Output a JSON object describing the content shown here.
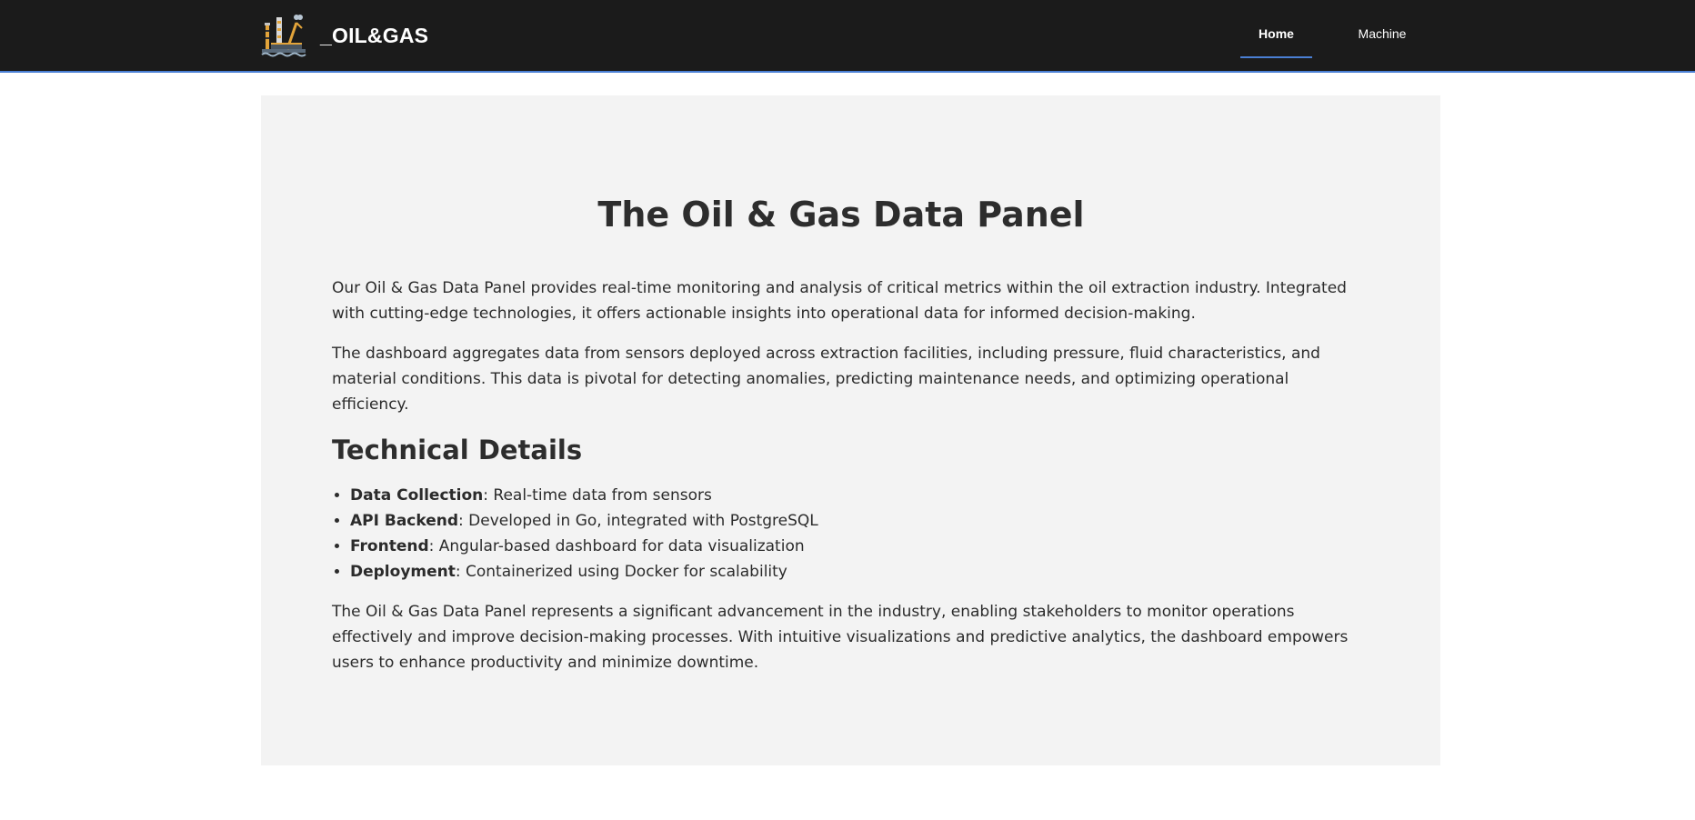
{
  "header": {
    "brand_name": "_OIL&GAS",
    "logo_icon": "oil-refinery-icon",
    "nav": [
      {
        "label": "Home",
        "active": true
      },
      {
        "label": "Machine",
        "active": false
      }
    ],
    "accent_color": "#4a7fd4",
    "background_color": "#1b1b1b"
  },
  "main": {
    "title": "The Oil & Gas Data Panel",
    "intro_paragraphs": [
      "Our Oil & Gas Data Panel provides real-time monitoring and analysis of critical metrics within the oil extraction industry. Integrated with cutting-edge technologies, it offers actionable insights into operational data for informed decision-making.",
      "The dashboard aggregates data from sensors deployed across extraction facilities, including pressure, fluid characteristics, and material conditions. This data is pivotal for detecting anomalies, predicting maintenance needs, and optimizing operational efficiency."
    ],
    "technical_heading": "Technical Details",
    "technical_items": [
      {
        "term": "Data Collection",
        "desc": ": Real-time data from sensors"
      },
      {
        "term": "API Backend",
        "desc": ": Developed in Go, integrated with PostgreSQL"
      },
      {
        "term": "Frontend",
        "desc": ": Angular-based dashboard for data visualization"
      },
      {
        "term": "Deployment",
        "desc": ": Containerized using Docker for scalability"
      }
    ],
    "closing_paragraph": "The Oil & Gas Data Panel represents a significant advancement in the industry, enabling stakeholders to monitor operations effectively and improve decision-making processes. With intuitive visualizations and predictive analytics, the dashboard empowers users to enhance productivity and minimize downtime."
  }
}
